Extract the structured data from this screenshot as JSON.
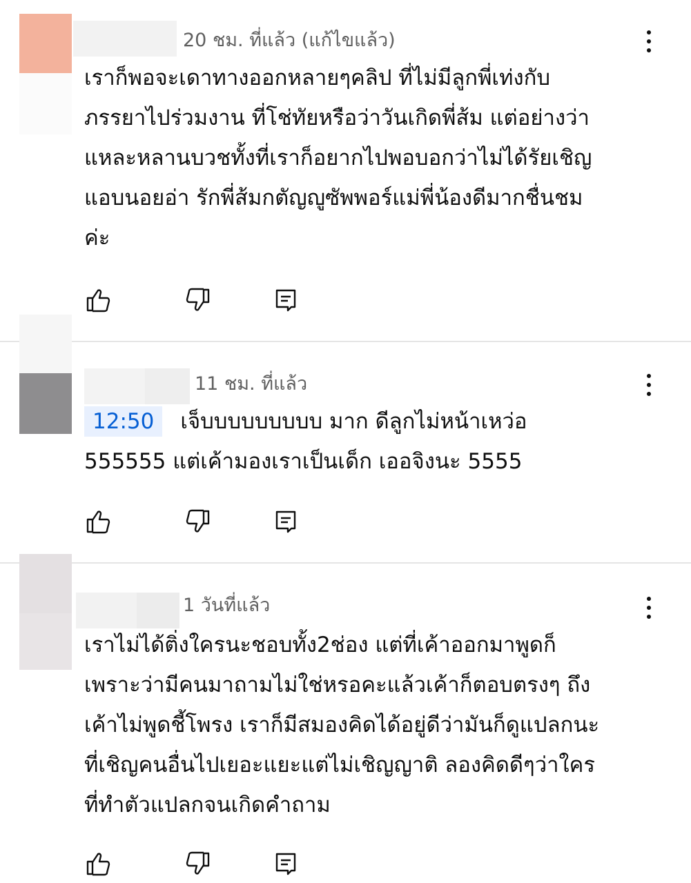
{
  "comments": [
    {
      "time": "20 ชม. ที่แล้ว (แก้ไขแล้ว)",
      "lines": [
        "เราก็พอจะเดาทางออกหลายๆคลิป ที่ไม่มีลูกพี่เท่งกับ",
        "ภรรยาไปร่วมงาน ที่โช่ทัยหรือว่าวันเกิดพี่ส้ม แต่อย่างว่า",
        "แหละหลานบวชทั้งที่เราก็อยากไปพอบอกว่าไม่ได้รัยเชิญ",
        "แอบนอยอ่า รักพี่ส้มกตัญญูซัพพอร์แม่พี่น้องดีมากชื่นชม",
        "ค่ะ"
      ]
    },
    {
      "time": "11 ชม. ที่แล้ว",
      "timestamp": "12:50",
      "lines": [
        "เจ็บบบบบบบบบ  มาก  ดีลูกไม่หน้าเหว่อ",
        "555555  แต่เค้ามองเราเป็นเด็ก  เออจิงนะ 5555"
      ]
    },
    {
      "time": "1 วันที่แล้ว",
      "lines": [
        "เราไม่ได้ติ่งใครนะชอบทั้ง2ช่อง แต่ที่เค้าออกมาพูดก็",
        "เพราะว่ามีคนมาถามไม่ใช่หรอคะแล้วเค้าก็ตอบตรงๆ ถึง",
        "เค้าไม่พูดชี้โพรง เราก็มีสมองคิดได้อยู่ดีว่ามันก็ดูแปลกนะ",
        "ที่เชิญคนอื่นไปเยอะแยะแต่ไม่เชิญญาติ ลองคิดดีๆว่าใคร",
        "ที่ทำตัวแปลกจนเกิดคำถาม"
      ]
    }
  ],
  "icons": {
    "like": "thumbs-up-icon",
    "dislike": "thumbs-down-icon",
    "reply": "reply-icon",
    "more": "more-vert-icon"
  },
  "colors": {
    "timestamp_bg": "#e8f0fe",
    "timestamp_text": "#065fd4",
    "meta_text": "#606060",
    "divider": "#e5e5e5"
  }
}
